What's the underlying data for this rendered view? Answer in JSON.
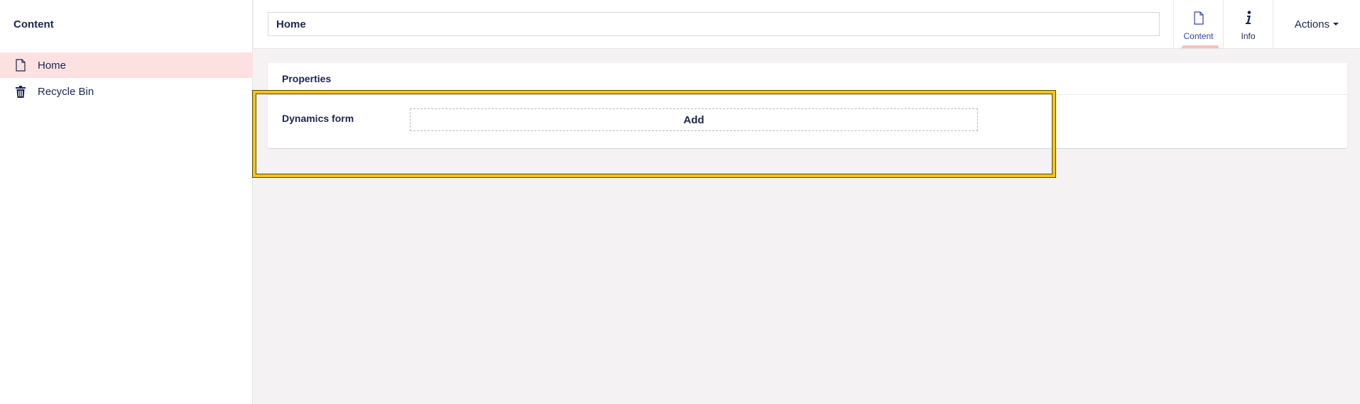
{
  "sidebar": {
    "title": "Content",
    "items": [
      {
        "label": "Home",
        "icon": "document-icon",
        "active": true
      },
      {
        "label": "Recycle Bin",
        "icon": "trash-icon",
        "active": false
      }
    ]
  },
  "header": {
    "name_value": "Home",
    "apps": [
      {
        "label": "Content",
        "icon": "document-icon",
        "active": true
      },
      {
        "label": "Info",
        "icon": "info-icon",
        "active": false
      }
    ],
    "actions_label": "Actions"
  },
  "panel": {
    "title": "Properties",
    "property_label": "Dynamics form",
    "add_label": "Add"
  },
  "colors": {
    "accent": "#f3c317",
    "active_item_bg": "#fde1e1",
    "text": "#1b264f",
    "tab_indicator": "#f5c1bc"
  }
}
